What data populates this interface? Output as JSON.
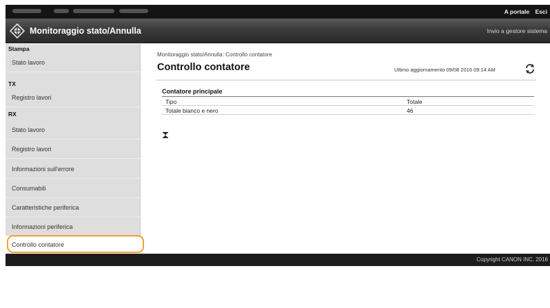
{
  "top_bar": {
    "links": [
      "A portale",
      "Esci"
    ]
  },
  "header": {
    "title": "Monitoraggio stato/Annulla",
    "right_link": "Invio a gestore sistema"
  },
  "sidebar": {
    "sections": [
      {
        "heading": "Stampa",
        "items": [
          "Stato lavoro"
        ]
      },
      {
        "heading": "TX",
        "items": [
          "Registro lavori"
        ]
      },
      {
        "heading": "RX",
        "items": [
          "Stato lavoro",
          "Registro lavori"
        ]
      }
    ],
    "other_items": [
      "Informazioni sull'errore",
      "Consumabili",
      "Caratteristiche periferica",
      "Informazioni periferica",
      "Controllo contatore"
    ],
    "selected": "Controllo contatore"
  },
  "main": {
    "breadcrumb": "Monitoraggio stato/Annulla: Controllo contatore",
    "title": "Controllo contatore",
    "last_update": "Ultimo aggiornamento 09/08 2016 09:14 AM",
    "counter_section": {
      "title": "Contatore principale",
      "headers": [
        "Tipo",
        "Totale"
      ],
      "rows": [
        [
          "Totale bianco e nero",
          "46"
        ]
      ]
    }
  },
  "footer": {
    "copyright": "Copyright CANON INC. 2016"
  },
  "colors": {
    "highlight": "#f0a030",
    "top_bar": "#141414",
    "sidebar_bg": "#dedede"
  },
  "icons": [
    "logo-icon",
    "refresh-icon",
    "hourglass-icon"
  ]
}
